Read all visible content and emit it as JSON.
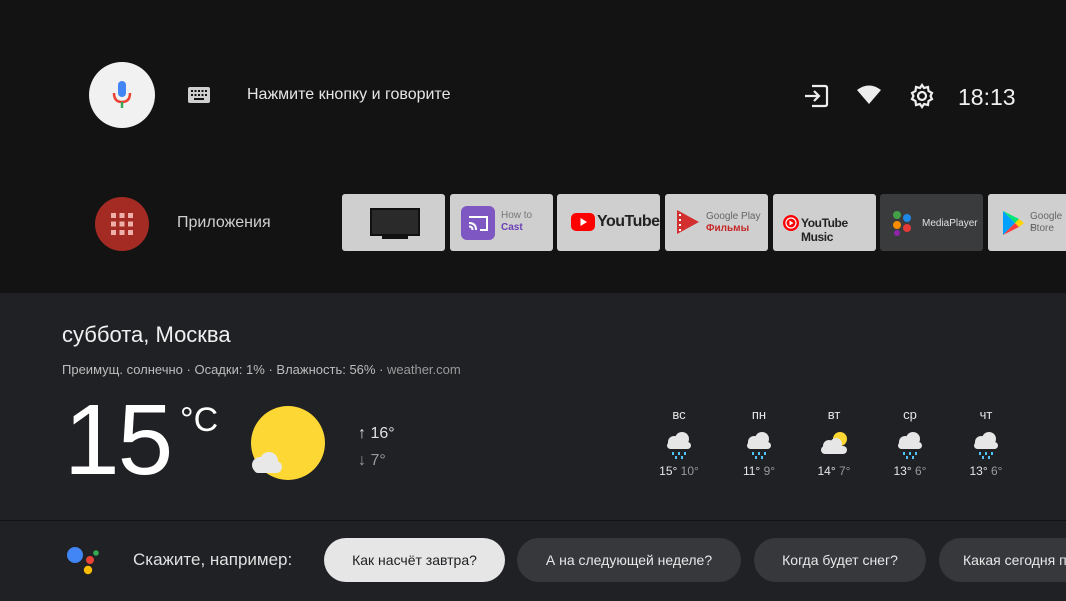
{
  "header": {
    "voice_prompt": "Нажмите кнопку и говорите",
    "clock": "18:13"
  },
  "apps_row": {
    "label": "Приложения",
    "tiles": [
      {
        "name": "TV",
        "line1": "",
        "line2": ""
      },
      {
        "name": "How to Cast",
        "line1": "How to",
        "line2": "Cast"
      },
      {
        "name": "YouTube",
        "line1": "YouTube",
        "line2": ""
      },
      {
        "name": "Google Play Фильмы",
        "line1": "Google Play",
        "line2": "Фильмы"
      },
      {
        "name": "YouTube Music",
        "line1": "YouTube Music",
        "line2": ""
      },
      {
        "name": "MediaPlayer",
        "line1": "MediaPlayer",
        "line2": ""
      },
      {
        "name": "Google Play Store",
        "line1": "Google P",
        "line2": "Store"
      }
    ]
  },
  "weather": {
    "location": "суббота, Москва",
    "conditions": "Преимущ. солнечно · Осадки: 1% · Влажность: 56% · ",
    "source": "weather.com",
    "temp": "15",
    "unit": "°C",
    "high": "↑ 16°",
    "low": "↓ 7°",
    "forecast": [
      {
        "day": "вс",
        "hi": "15°",
        "lo": "10°",
        "icon": "rain-cloud-icon"
      },
      {
        "day": "пн",
        "hi": "11°",
        "lo": "9°",
        "icon": "rain-cloud-icon"
      },
      {
        "day": "вт",
        "hi": "14°",
        "lo": "7°",
        "icon": "partly-sunny-icon"
      },
      {
        "day": "ср",
        "hi": "13°",
        "lo": "6°",
        "icon": "rain-cloud-icon"
      },
      {
        "day": "чт",
        "hi": "13°",
        "lo": "6°",
        "icon": "rain-cloud-icon"
      }
    ]
  },
  "assistant": {
    "say_label": "Скажите, например:",
    "chips": [
      "Как насчёт завтра?",
      "А на следующей неделе?",
      "Когда будет снег?",
      "Какая сегодня п"
    ]
  },
  "colors": {
    "apps_button": "#a42a24",
    "sun": "#fdd835",
    "rain": "#4fc3f7",
    "youtube_red": "#ff0000"
  }
}
